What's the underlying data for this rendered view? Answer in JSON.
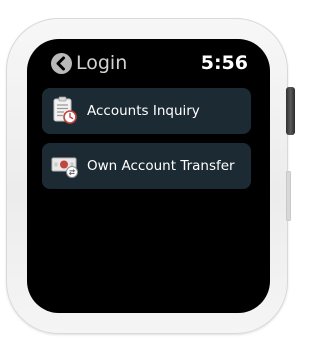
{
  "header": {
    "back_label": "Login",
    "time": "5:56"
  },
  "menu": {
    "items": [
      {
        "label": "Accounts Inquiry",
        "icon": "clipboard-clock-icon"
      },
      {
        "label": "Own Account Transfer",
        "icon": "money-transfer-icon"
      }
    ]
  },
  "colors": {
    "screen_background": "#000000",
    "menu_item_background": "#1c2b33",
    "icon_accent": "#c0463f"
  }
}
